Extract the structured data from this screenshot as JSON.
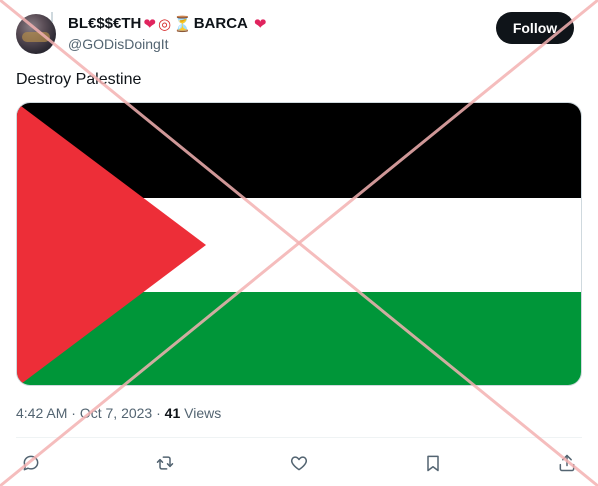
{
  "tweet": {
    "display_name": "BL€$$€TH",
    "display_name_suffix": "BARCA",
    "emojis": [
      "heart-icon",
      "target-icon",
      "hourglass-icon",
      "heart-icon"
    ],
    "handle": "@GODisDoingIt",
    "follow_label": "Follow",
    "text": "Destroy Palestine",
    "time": "4:42 AM",
    "separator": " · ",
    "date": "Oct 7, 2023",
    "views_count": "41",
    "views_label": " Views"
  },
  "media": {
    "type": "flag-image",
    "colors": {
      "top": "#000000",
      "middle": "#ffffff",
      "bottom": "#009639",
      "triangle": "#ed2e38"
    }
  },
  "actions": [
    "reply-icon",
    "retweet-icon",
    "like-icon",
    "bookmark-icon",
    "share-icon"
  ],
  "overlay": {
    "type": "red-x",
    "color": "#f4b2b2"
  },
  "colors": {
    "text_primary": "#0f1419",
    "text_secondary": "#536471",
    "button_bg": "#0f1419"
  }
}
